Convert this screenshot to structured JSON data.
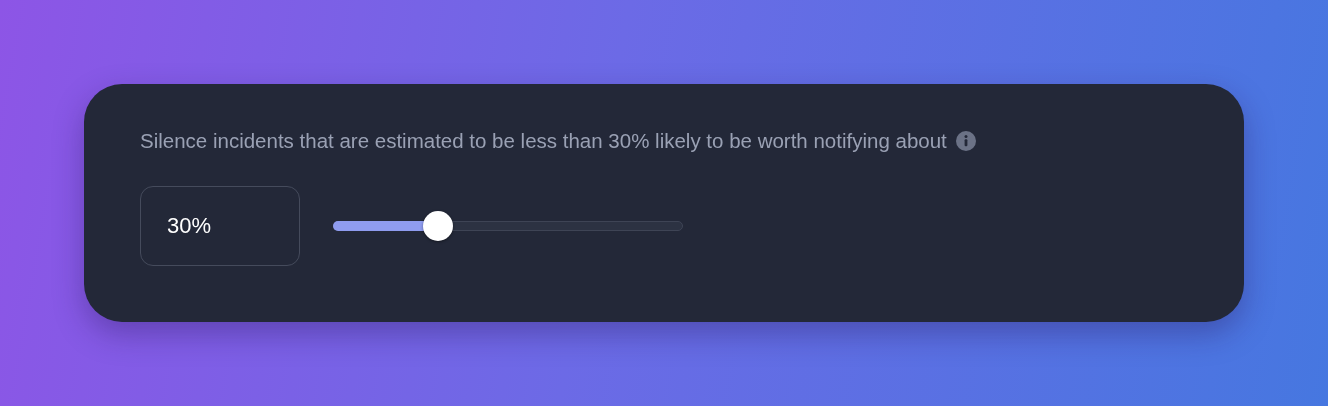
{
  "setting": {
    "label": "Silence incidents that are estimated to be less than 30% likely to be worth notifying about",
    "value": "30%",
    "slider": {
      "level": 0.3
    }
  }
}
